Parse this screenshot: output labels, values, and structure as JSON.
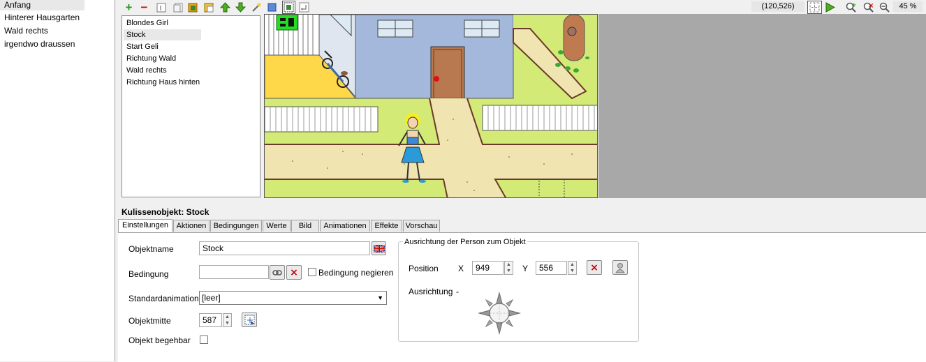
{
  "scenes": {
    "items": [
      {
        "label": "Anfang",
        "selected": true
      },
      {
        "label": "Hinterer Hausgarten",
        "selected": false
      },
      {
        "label": "Wald rechts",
        "selected": false
      },
      {
        "label": "irgendwo draussen",
        "selected": false
      }
    ]
  },
  "toolbar": {
    "coordinates": "(120,526)",
    "zoom": "45 %"
  },
  "objects": {
    "items": [
      {
        "label": "Blondes Girl",
        "selected": false
      },
      {
        "label": "Stock",
        "selected": true
      },
      {
        "label": "Start Geli",
        "selected": false
      },
      {
        "label": "Richtung Wald",
        "selected": false
      },
      {
        "label": "Wald rechts",
        "selected": false
      },
      {
        "label": "Richtung Haus hinten",
        "selected": false
      }
    ]
  },
  "panel": {
    "title": "Kulissenobjekt: Stock",
    "tabs": [
      {
        "label": "Einstellungen",
        "active": true
      },
      {
        "label": "Aktionen",
        "active": false
      },
      {
        "label": "Bedingungen",
        "active": false
      },
      {
        "label": "Werte",
        "active": false
      },
      {
        "label": "Bild",
        "active": false
      },
      {
        "label": "Animationen",
        "active": false
      },
      {
        "label": "Effekte",
        "active": false
      },
      {
        "label": "Vorschau",
        "active": false
      }
    ]
  },
  "settings": {
    "objectname_label": "Objektname",
    "objectname_value": "Stock",
    "condition_label": "Bedingung",
    "condition_value": "",
    "negate_label": "Bedingung negieren",
    "animation_label": "Standardanimation",
    "animation_value": "[leer]",
    "center_label": "Objektmitte",
    "center_value": "587",
    "walkable_label": "Objekt begehbar"
  },
  "orientation": {
    "title": "Ausrichtung der Person zum Objekt",
    "position_label": "Position",
    "x_label": "X",
    "x_value": "949",
    "y_label": "Y",
    "y_value": "556",
    "direction_label": "Ausrichtung",
    "direction_value": "-"
  }
}
